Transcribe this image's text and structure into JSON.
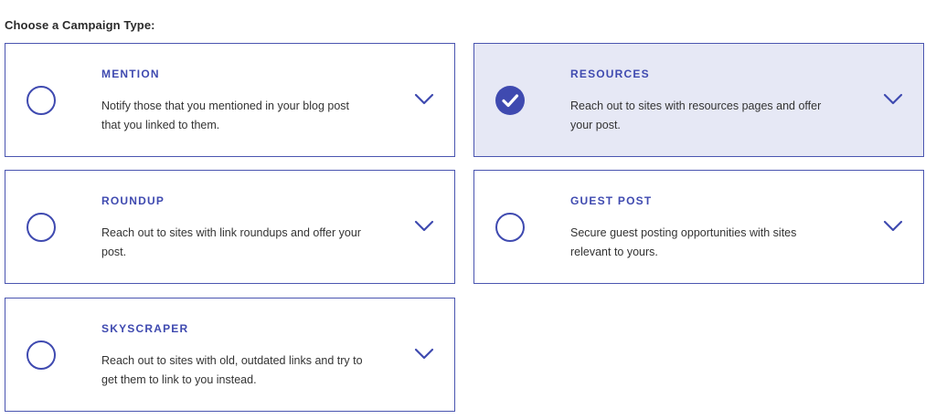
{
  "heading": "Choose a Campaign Type:",
  "accent_color": "#3f4ab0",
  "selected_bg": "#e6e8f5",
  "campaigns": [
    {
      "title": "MENTION",
      "description": "Notify those that you mentioned in your blog post that you linked to them.",
      "selected": false
    },
    {
      "title": "RESOURCES",
      "description": "Reach out to sites with resources pages and offer your post.",
      "selected": true
    },
    {
      "title": "ROUNDUP",
      "description": "Reach out to sites with link roundups and offer your post.",
      "selected": false
    },
    {
      "title": "GUEST POST",
      "description": "Secure guest posting opportunities with sites relevant to yours.",
      "selected": false
    },
    {
      "title": "SKYSCRAPER",
      "description": "Reach out to sites with old, outdated links and try to get them to link to you instead.",
      "selected": false
    }
  ],
  "icons": {
    "unselected": "radio-circle-icon",
    "selected": "check-circle-icon",
    "expand": "chevron-down-icon"
  }
}
